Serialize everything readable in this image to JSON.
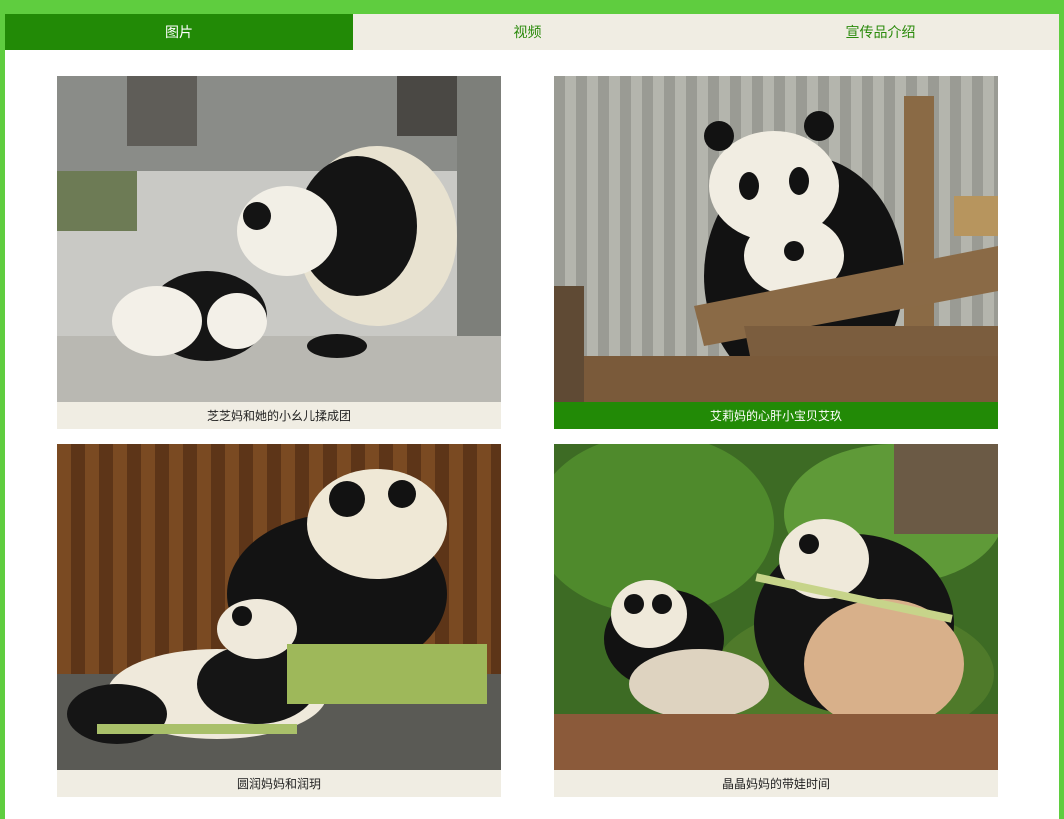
{
  "tabs": [
    {
      "label": "图片",
      "active": true
    },
    {
      "label": "视频",
      "active": false
    },
    {
      "label": "宣传品介绍",
      "active": false
    }
  ],
  "gallery": [
    {
      "caption": "芝芝妈和她的小幺儿揉成团",
      "scene": "giant panda mother cuddling cub on concrete enclosure floor"
    },
    {
      "caption": "艾莉妈的心肝小宝贝艾玖",
      "scene": "giant panda mother hugging cub on wooden log climbing frame"
    },
    {
      "caption": "圆润妈妈和润玥",
      "scene": "giant panda mother and cub eating bamboo beside wooden fence"
    },
    {
      "caption": "晶晶妈妈的带娃时间",
      "scene": "giant panda mother and cub eating bamboo among green plants"
    }
  ],
  "colors": {
    "border_green": "#5fcd3f",
    "active_green": "#228a06",
    "tab_bg": "#f0ede3",
    "tab_text": "#2a8a0b"
  }
}
